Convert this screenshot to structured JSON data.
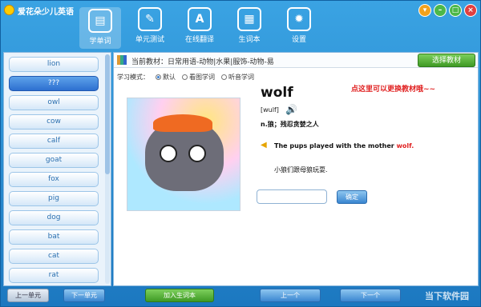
{
  "title": "爱花朵少儿英语",
  "tabs": [
    {
      "label": "学单词",
      "icon": "book-icon"
    },
    {
      "label": "单元测试",
      "icon": "edit-icon"
    },
    {
      "label": "在线翻译",
      "icon": "translate-icon"
    },
    {
      "label": "生词本",
      "icon": "calendar-icon"
    },
    {
      "label": "设置",
      "icon": "gear-icon"
    }
  ],
  "words": [
    "lion",
    "???",
    "owl",
    "cow",
    "calf",
    "goat",
    "fox",
    "pig",
    "dog",
    "bat",
    "cat",
    "rat"
  ],
  "current": "当前教材：日常用语-动物|水果|服饰-动物-易",
  "choose": "选择教材",
  "mode_label": "学习模式：",
  "modes": [
    "默认",
    "看图学词",
    "听音学词"
  ],
  "hint": "点这里可以更换教材哦~~",
  "word": "wolf",
  "phonetic": "[wulf]",
  "meaning": "n.狼；残忍贪婪之人",
  "sentence_pre": "The pups played with the mother ",
  "sentence_hl": "wolf.",
  "translation": "小狼们跟母狼玩耍.",
  "ok": "确定",
  "buttons": {
    "prev_unit": "上一单元",
    "next_unit": "下一单元",
    "add": "加入生词本",
    "prev": "上一个",
    "next": "下一个"
  },
  "watermark": "当下软件园"
}
